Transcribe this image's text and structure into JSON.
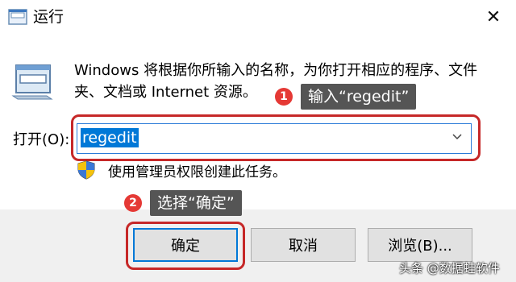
{
  "window": {
    "title": "运行",
    "close_symbol": "✕"
  },
  "dialog": {
    "description": "Windows 将根据你所输入的名称，为你打开相应的程序、文件夹、文档或 Internet 资源。",
    "open_label": "打开(O):",
    "command_value": "regedit",
    "admin_note": "使用管理员权限创建此任务。"
  },
  "buttons": {
    "ok": "确定",
    "cancel": "取消",
    "browse": "浏览(B)..."
  },
  "annotations": [
    {
      "number": "1",
      "text": "输入“regedit”"
    },
    {
      "number": "2",
      "text": "选择“确定”"
    }
  ],
  "watermark": "头条 @数据蛙软件",
  "icons": [
    "run-app-icon",
    "run-program-icon",
    "close-icon",
    "chevron-down-icon",
    "uac-shield-icon"
  ],
  "colors": {
    "selection": "#0078d7",
    "annotation_red": "#c62828",
    "badge_red": "#e53935",
    "tooltip_gray": "#555555",
    "footer_bg": "#f0f0f0"
  }
}
